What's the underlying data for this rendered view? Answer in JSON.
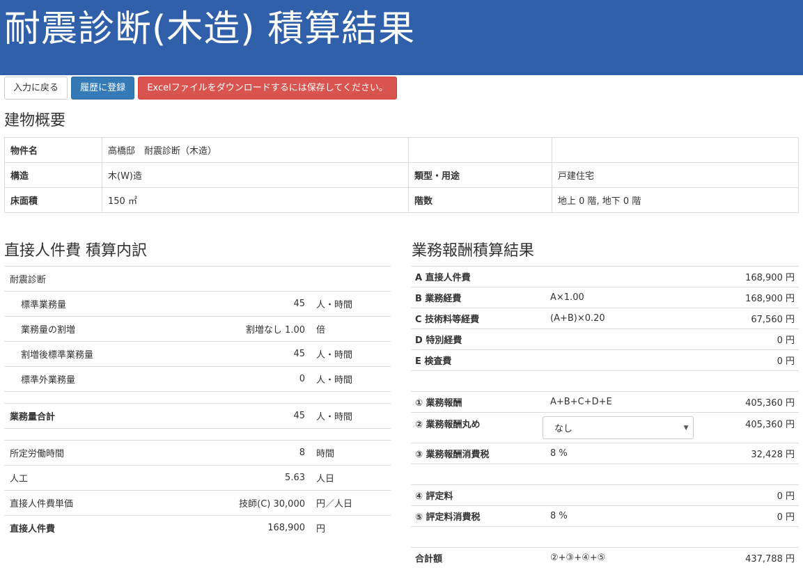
{
  "header": {
    "title": "耐震診断(木造) 積算結果"
  },
  "toolbar": {
    "back_label": "入力に戻る",
    "register_label": "履歴に登録",
    "excel_notice": "Excelファイルをダウンロードするには保存してください。"
  },
  "overview": {
    "title": "建物概要",
    "rows": [
      {
        "l1": "物件名",
        "v1": "高橋邸　耐震診断（木造）",
        "l2": "",
        "v2": ""
      },
      {
        "l1": "構造",
        "v1": "木(W)造",
        "l2": "類型・用途",
        "v2": "戸建住宅"
      },
      {
        "l1": "床面積",
        "v1": "150 ㎡",
        "l2": "階数",
        "v2": "地上 0 階, 地下 0 階"
      }
    ]
  },
  "labor": {
    "title": "直接人件費 積算内訳",
    "section": "耐震診断",
    "standard": {
      "name": "標準業務量",
      "value": "45",
      "unit": "人・時間"
    },
    "increase": {
      "name": "業務量の割増",
      "value": "割増なし 1.00",
      "unit": "倍"
    },
    "after": {
      "name": "割増後標準業務量",
      "value": "45",
      "unit": "人・時間"
    },
    "outside": {
      "name": "標準外業務量",
      "value": "0",
      "unit": "人・時間"
    },
    "total": {
      "name": "業務量合計",
      "value": "45",
      "unit": "人・時間"
    },
    "hours": {
      "name": "所定労働時間",
      "value": "8",
      "unit": "時間"
    },
    "ninku": {
      "name": "人工",
      "value": "5.63",
      "unit": "人日"
    },
    "unit_price": {
      "name": "直接人件費単価",
      "value": "技師(C) 30,000",
      "unit": "円／人日"
    },
    "direct": {
      "name": "直接人件費",
      "value": "168,900",
      "unit": "円"
    }
  },
  "fee": {
    "title": "業務報酬積算結果",
    "a": {
      "name": "A 直接人件費",
      "formula": "",
      "amount": "168,900 円"
    },
    "b": {
      "name": "B 業務経費",
      "formula": "A×1.00",
      "amount": "168,900 円"
    },
    "c": {
      "name": "C 技術料等経費",
      "formula": "(A+B)×0.20",
      "amount": "67,560 円"
    },
    "d": {
      "name": "D 特別経費",
      "formula": "",
      "amount": "0 円"
    },
    "e": {
      "name": "E 検査費",
      "formula": "",
      "amount": "0 円"
    },
    "r1": {
      "name": "① 業務報酬",
      "formula": "A+B+C+D+E",
      "amount": "405,360 円"
    },
    "r2": {
      "name": "② 業務報酬丸め",
      "select_value": "なし",
      "amount": "405,360 円"
    },
    "r3": {
      "name": "③ 業務報酬消費税",
      "formula": "8 %",
      "amount": "32,428 円"
    },
    "r4": {
      "name": "④ 評定料",
      "formula": "",
      "amount": "0 円"
    },
    "r5": {
      "name": "⑤ 評定料消費税",
      "formula": "8 %",
      "amount": "0 円"
    },
    "total": {
      "name": "合計額",
      "formula": "②+③+④+⑤",
      "amount": "437,788 円"
    }
  }
}
